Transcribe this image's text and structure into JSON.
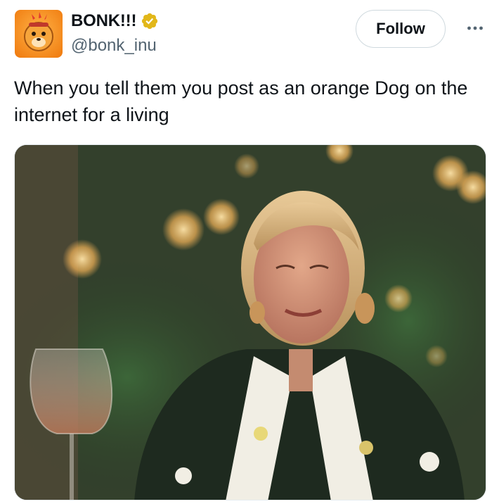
{
  "author": {
    "display_name": "BONK!!!",
    "handle": "@bonk_inu",
    "verified_icon": "verified-badge-icon",
    "verified_color": "#e2b719"
  },
  "actions": {
    "follow_label": "Follow",
    "more_icon": "more-horizontal-icon"
  },
  "tweet": {
    "text": "When you tell them you post as an orange Dog on the internet for a living"
  },
  "colors": {
    "avatar_bg": "#f7931a",
    "text": "#0f1419",
    "muted": "#536471"
  }
}
